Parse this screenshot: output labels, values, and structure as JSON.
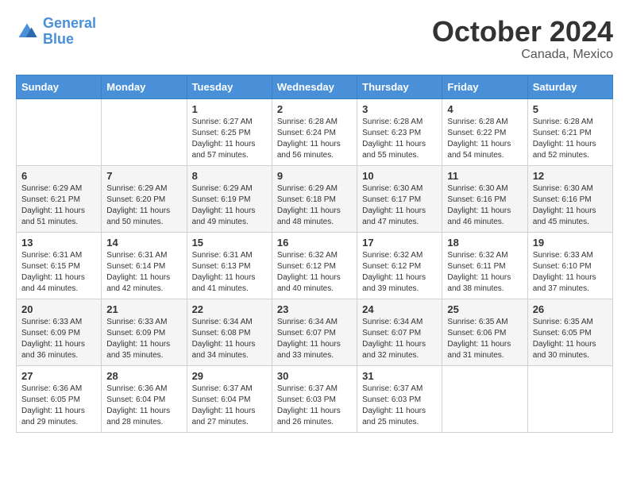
{
  "logo": {
    "line1": "General",
    "line2": "Blue"
  },
  "title": "October 2024",
  "subtitle": "Canada, Mexico",
  "days_of_week": [
    "Sunday",
    "Monday",
    "Tuesday",
    "Wednesday",
    "Thursday",
    "Friday",
    "Saturday"
  ],
  "weeks": [
    [
      {
        "day": "",
        "info": ""
      },
      {
        "day": "",
        "info": ""
      },
      {
        "day": "1",
        "info": "Sunrise: 6:27 AM\nSunset: 6:25 PM\nDaylight: 11 hours and 57 minutes."
      },
      {
        "day": "2",
        "info": "Sunrise: 6:28 AM\nSunset: 6:24 PM\nDaylight: 11 hours and 56 minutes."
      },
      {
        "day": "3",
        "info": "Sunrise: 6:28 AM\nSunset: 6:23 PM\nDaylight: 11 hours and 55 minutes."
      },
      {
        "day": "4",
        "info": "Sunrise: 6:28 AM\nSunset: 6:22 PM\nDaylight: 11 hours and 54 minutes."
      },
      {
        "day": "5",
        "info": "Sunrise: 6:28 AM\nSunset: 6:21 PM\nDaylight: 11 hours and 52 minutes."
      }
    ],
    [
      {
        "day": "6",
        "info": "Sunrise: 6:29 AM\nSunset: 6:21 PM\nDaylight: 11 hours and 51 minutes."
      },
      {
        "day": "7",
        "info": "Sunrise: 6:29 AM\nSunset: 6:20 PM\nDaylight: 11 hours and 50 minutes."
      },
      {
        "day": "8",
        "info": "Sunrise: 6:29 AM\nSunset: 6:19 PM\nDaylight: 11 hours and 49 minutes."
      },
      {
        "day": "9",
        "info": "Sunrise: 6:29 AM\nSunset: 6:18 PM\nDaylight: 11 hours and 48 minutes."
      },
      {
        "day": "10",
        "info": "Sunrise: 6:30 AM\nSunset: 6:17 PM\nDaylight: 11 hours and 47 minutes."
      },
      {
        "day": "11",
        "info": "Sunrise: 6:30 AM\nSunset: 6:16 PM\nDaylight: 11 hours and 46 minutes."
      },
      {
        "day": "12",
        "info": "Sunrise: 6:30 AM\nSunset: 6:16 PM\nDaylight: 11 hours and 45 minutes."
      }
    ],
    [
      {
        "day": "13",
        "info": "Sunrise: 6:31 AM\nSunset: 6:15 PM\nDaylight: 11 hours and 44 minutes."
      },
      {
        "day": "14",
        "info": "Sunrise: 6:31 AM\nSunset: 6:14 PM\nDaylight: 11 hours and 42 minutes."
      },
      {
        "day": "15",
        "info": "Sunrise: 6:31 AM\nSunset: 6:13 PM\nDaylight: 11 hours and 41 minutes."
      },
      {
        "day": "16",
        "info": "Sunrise: 6:32 AM\nSunset: 6:12 PM\nDaylight: 11 hours and 40 minutes."
      },
      {
        "day": "17",
        "info": "Sunrise: 6:32 AM\nSunset: 6:12 PM\nDaylight: 11 hours and 39 minutes."
      },
      {
        "day": "18",
        "info": "Sunrise: 6:32 AM\nSunset: 6:11 PM\nDaylight: 11 hours and 38 minutes."
      },
      {
        "day": "19",
        "info": "Sunrise: 6:33 AM\nSunset: 6:10 PM\nDaylight: 11 hours and 37 minutes."
      }
    ],
    [
      {
        "day": "20",
        "info": "Sunrise: 6:33 AM\nSunset: 6:09 PM\nDaylight: 11 hours and 36 minutes."
      },
      {
        "day": "21",
        "info": "Sunrise: 6:33 AM\nSunset: 6:09 PM\nDaylight: 11 hours and 35 minutes."
      },
      {
        "day": "22",
        "info": "Sunrise: 6:34 AM\nSunset: 6:08 PM\nDaylight: 11 hours and 34 minutes."
      },
      {
        "day": "23",
        "info": "Sunrise: 6:34 AM\nSunset: 6:07 PM\nDaylight: 11 hours and 33 minutes."
      },
      {
        "day": "24",
        "info": "Sunrise: 6:34 AM\nSunset: 6:07 PM\nDaylight: 11 hours and 32 minutes."
      },
      {
        "day": "25",
        "info": "Sunrise: 6:35 AM\nSunset: 6:06 PM\nDaylight: 11 hours and 31 minutes."
      },
      {
        "day": "26",
        "info": "Sunrise: 6:35 AM\nSunset: 6:05 PM\nDaylight: 11 hours and 30 minutes."
      }
    ],
    [
      {
        "day": "27",
        "info": "Sunrise: 6:36 AM\nSunset: 6:05 PM\nDaylight: 11 hours and 29 minutes."
      },
      {
        "day": "28",
        "info": "Sunrise: 6:36 AM\nSunset: 6:04 PM\nDaylight: 11 hours and 28 minutes."
      },
      {
        "day": "29",
        "info": "Sunrise: 6:37 AM\nSunset: 6:04 PM\nDaylight: 11 hours and 27 minutes."
      },
      {
        "day": "30",
        "info": "Sunrise: 6:37 AM\nSunset: 6:03 PM\nDaylight: 11 hours and 26 minutes."
      },
      {
        "day": "31",
        "info": "Sunrise: 6:37 AM\nSunset: 6:03 PM\nDaylight: 11 hours and 25 minutes."
      },
      {
        "day": "",
        "info": ""
      },
      {
        "day": "",
        "info": ""
      }
    ]
  ]
}
